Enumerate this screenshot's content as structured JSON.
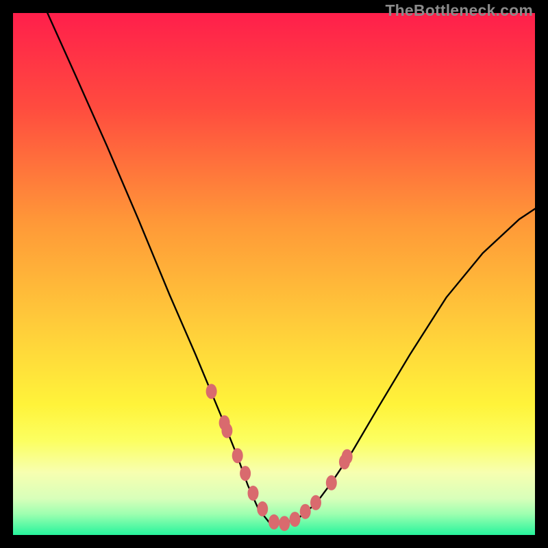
{
  "watermark": "TheBottleneck.com",
  "colors": {
    "frame": "#000000",
    "watermark": "#8b8b8b",
    "gradient_stops": [
      {
        "pct": 0,
        "color": "#ff1f4b"
      },
      {
        "pct": 18,
        "color": "#ff4b3f"
      },
      {
        "pct": 40,
        "color": "#ff9838"
      },
      {
        "pct": 62,
        "color": "#ffd23a"
      },
      {
        "pct": 75,
        "color": "#fff33a"
      },
      {
        "pct": 82,
        "color": "#fcff61"
      },
      {
        "pct": 88,
        "color": "#f7ffb0"
      },
      {
        "pct": 93,
        "color": "#d8ffba"
      },
      {
        "pct": 96,
        "color": "#9dffb0"
      },
      {
        "pct": 100,
        "color": "#26f49c"
      }
    ],
    "curve": "#000000",
    "marker_fill": "#d96a6e"
  },
  "chart_data": {
    "type": "line",
    "title": "",
    "xlabel": "",
    "ylabel": "",
    "xlim": [
      0,
      1
    ],
    "ylim": [
      0,
      1
    ],
    "note": "V-shaped bottleneck curve; x is normalized horizontal position, y is normalized height (0 = bottom/green, 1 = top/red). Minimum (optimal) sits near x≈0.49.",
    "series": [
      {
        "name": "bottleneck-curve",
        "x": [
          0.066,
          0.12,
          0.18,
          0.24,
          0.3,
          0.35,
          0.4,
          0.43,
          0.45,
          0.47,
          0.49,
          0.52,
          0.55,
          0.58,
          0.61,
          0.65,
          0.7,
          0.76,
          0.83,
          0.9,
          0.97,
          1.0
        ],
        "y": [
          1.0,
          0.88,
          0.745,
          0.605,
          0.46,
          0.345,
          0.225,
          0.15,
          0.095,
          0.05,
          0.025,
          0.022,
          0.035,
          0.06,
          0.1,
          0.16,
          0.245,
          0.345,
          0.455,
          0.54,
          0.605,
          0.625
        ]
      }
    ],
    "markers": {
      "name": "highlight-dots",
      "x": [
        0.38,
        0.405,
        0.41,
        0.43,
        0.445,
        0.46,
        0.478,
        0.5,
        0.52,
        0.54,
        0.56,
        0.58,
        0.61,
        0.635,
        0.64
      ],
      "y": [
        0.275,
        0.215,
        0.2,
        0.152,
        0.118,
        0.08,
        0.05,
        0.025,
        0.022,
        0.03,
        0.045,
        0.062,
        0.1,
        0.14,
        0.15
      ]
    }
  }
}
